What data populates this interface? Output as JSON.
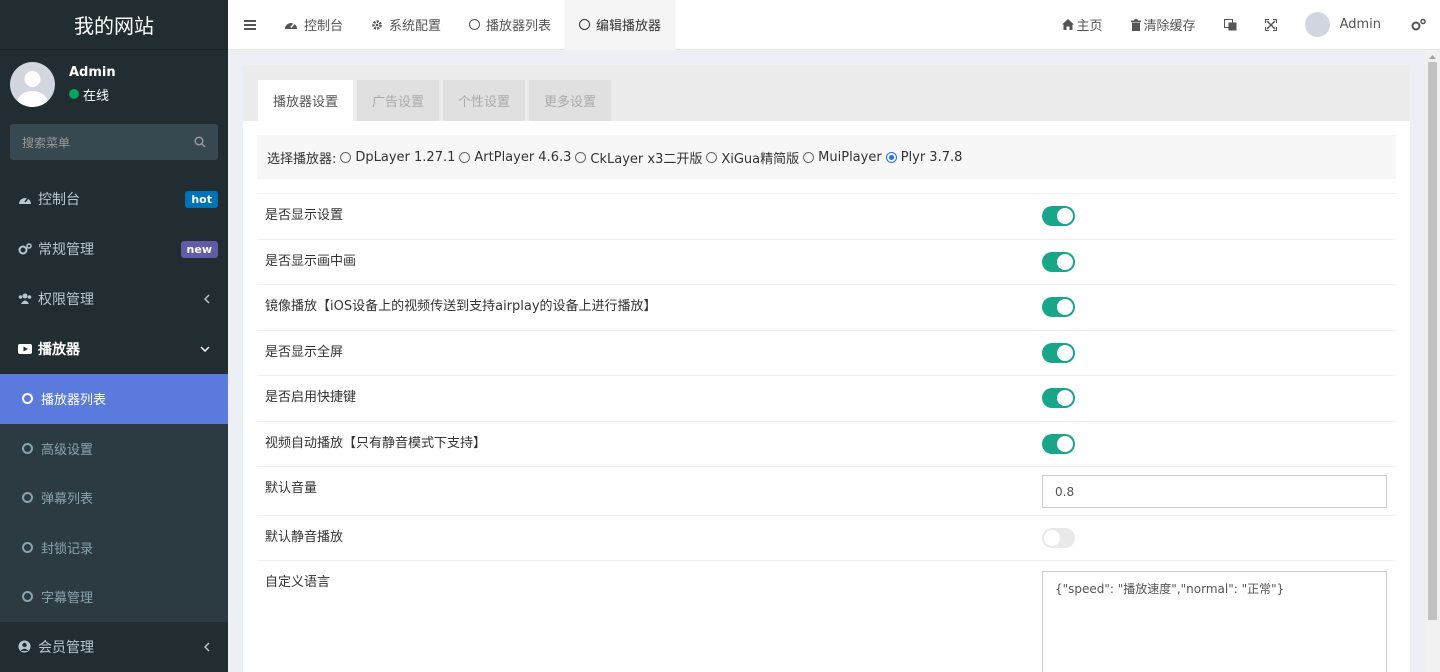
{
  "site": {
    "title": "我的网站"
  },
  "user": {
    "name": "Admin",
    "status": "在线"
  },
  "search": {
    "placeholder": "搜索菜单"
  },
  "menu": {
    "dashboard": {
      "label": "控制台",
      "badge": "hot"
    },
    "general": {
      "label": "常规管理",
      "badge": "new"
    },
    "perm": {
      "label": "权限管理"
    },
    "player": {
      "label": "播放器"
    },
    "sub": [
      {
        "label": "播放器列表"
      },
      {
        "label": "高级设置"
      },
      {
        "label": "弹幕列表"
      },
      {
        "label": "封锁记录"
      },
      {
        "label": "字幕管理"
      }
    ],
    "member": {
      "label": "会员管理"
    }
  },
  "topbar": {
    "tabs": [
      {
        "label": "控制台"
      },
      {
        "label": "系统配置"
      },
      {
        "label": "播放器列表"
      },
      {
        "label": "编辑播放器"
      }
    ],
    "home": "主页",
    "clear": "清除缓存",
    "admin": "Admin"
  },
  "content": {
    "tabs": [
      {
        "label": "播放器设置"
      },
      {
        "label": "广告设置"
      },
      {
        "label": "个性设置"
      },
      {
        "label": "更多设置"
      }
    ],
    "player_label": "选择播放器:",
    "players": [
      {
        "label": "DpLayer 1.27.1"
      },
      {
        "label": "ArtPlayer 4.6.3"
      },
      {
        "label": "CkLayer x3二开版"
      },
      {
        "label": "XiGua精简版"
      },
      {
        "label": "MuiPlayer"
      },
      {
        "label": "Plyr 3.7.8"
      }
    ],
    "selected_player": "Plyr 3.7.8",
    "settings": [
      {
        "label": "是否显示设置",
        "on": true
      },
      {
        "label": "是否显示画中画",
        "on": true
      },
      {
        "label": "镜像播放【iOS设备上的视频传送到支持airplay的设备上进行播放】",
        "on": true
      },
      {
        "label": "是否显示全屏",
        "on": true
      },
      {
        "label": "是否启用快捷键",
        "on": true
      },
      {
        "label": "视频自动播放【只有静音模式下支持】",
        "on": true
      },
      {
        "label": "默认音量",
        "value": "0.8"
      },
      {
        "label": "默认静音播放",
        "on": false
      },
      {
        "label": "自定义语言",
        "value": "{\"speed\": \"播放速度\",\"normal\": \"正常\"}"
      }
    ]
  },
  "colors": {
    "sidebar": "#222d32",
    "active_item": "#5a7bdd",
    "toggle_on": "#18a689",
    "badge_hot": "#0073b7",
    "badge_new": "#605ca8"
  }
}
